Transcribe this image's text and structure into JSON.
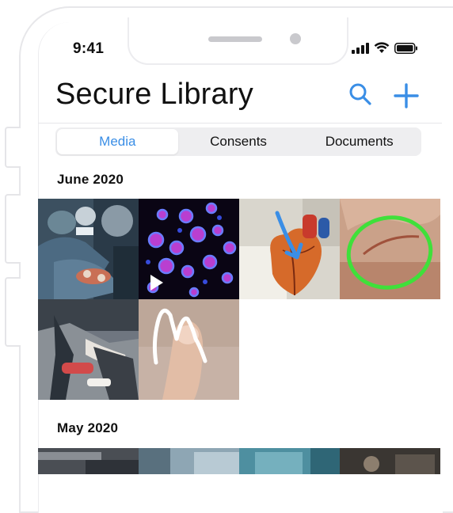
{
  "status": {
    "time": "9:41"
  },
  "header": {
    "title": "Secure Library",
    "search_icon": "search-icon",
    "add_icon": "plus-icon"
  },
  "tabs": [
    {
      "label": "Media",
      "active": true
    },
    {
      "label": "Consents",
      "active": false
    },
    {
      "label": "Documents",
      "active": false
    }
  ],
  "sections": [
    {
      "label": "June 2020"
    },
    {
      "label": "May 2020"
    }
  ],
  "accent_color": "#3a8ee6"
}
